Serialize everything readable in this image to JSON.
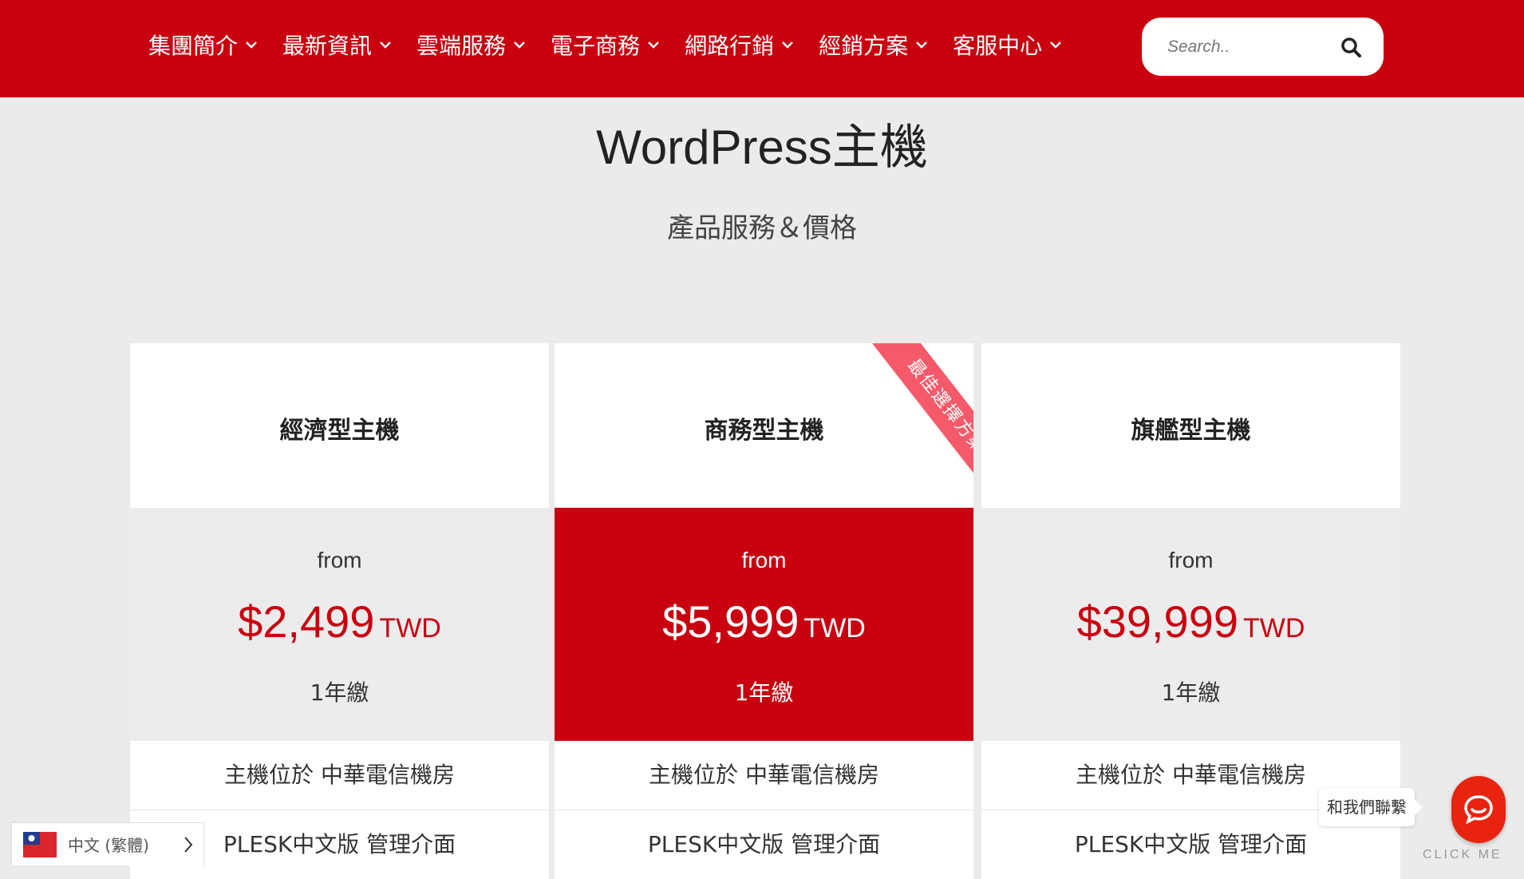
{
  "nav": {
    "items": [
      {
        "label": "集團簡介"
      },
      {
        "label": "最新資訊"
      },
      {
        "label": "雲端服務"
      },
      {
        "label": "電子商務"
      },
      {
        "label": "網路行銷"
      },
      {
        "label": "經銷方案"
      },
      {
        "label": "客服中心"
      }
    ]
  },
  "search": {
    "placeholder": "Search.."
  },
  "page": {
    "title": "WordPress主機",
    "subtitle": "產品服務＆價格"
  },
  "plans": [
    {
      "name": "經濟型主機",
      "from": "from",
      "amount": "$2,499",
      "currency": "TWD",
      "period": "1年繳",
      "features": [
        "主機位於 中華電信機房",
        "PLESK中文版 管理介面"
      ]
    },
    {
      "name": "商務型主機",
      "from": "from",
      "amount": "$5,999",
      "currency": "TWD",
      "period": "1年繳",
      "features": [
        "主機位於 中華電信機房",
        "PLESK中文版 管理介面"
      ]
    },
    {
      "name": "旗艦型主機",
      "from": "from",
      "amount": "$39,999",
      "currency": "TWD",
      "period": "1年繳",
      "features": [
        "主機位於 中華電信機房",
        "PLESK中文版 管理介面"
      ]
    }
  ],
  "ribbon": {
    "label": "最佳選擇方案"
  },
  "language": {
    "label": "中文 (繁體)"
  },
  "chat": {
    "bubble": "和我們聯繫",
    "click_me": "CLICK ME"
  },
  "colors": {
    "brand_red": "#c8000f",
    "ribbon_pink": "#f55a6a",
    "chat_orange": "#e8230f"
  }
}
